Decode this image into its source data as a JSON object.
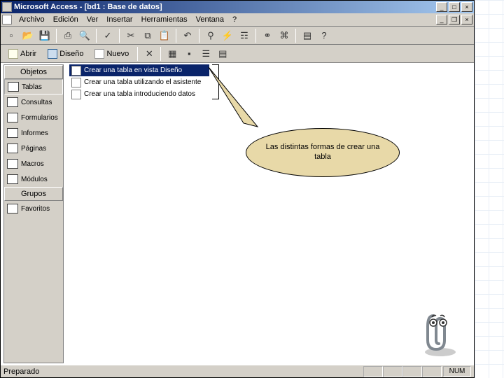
{
  "title": "Microsoft Access - [bd1 : Base de datos]",
  "menu": {
    "items": [
      "Archivo",
      "Edición",
      "Ver",
      "Insertar",
      "Herramientas",
      "Ventana",
      "?"
    ]
  },
  "toolbar1": {
    "icons": [
      "new-doc-icon",
      "open-icon",
      "save-icon",
      "print-icon",
      "preview-icon",
      "spell-icon",
      "cut-icon",
      "copy-icon",
      "paste-icon",
      "undo-icon",
      "link-icon",
      "analyze-icon",
      "props-icon",
      "relations-icon",
      "code-icon",
      "window-icon",
      "help-icon"
    ]
  },
  "toolbar2": {
    "open_label": "Abrir",
    "design_label": "Diseño",
    "new_label": "Nuevo",
    "view_icons": [
      "delete-icon",
      "large-icons-icon",
      "small-icons-icon",
      "list-icon",
      "details-icon"
    ]
  },
  "sidebar": {
    "header_objects": "Objetos",
    "items": [
      {
        "label": "Tablas"
      },
      {
        "label": "Consultas"
      },
      {
        "label": "Formularios"
      },
      {
        "label": "Informes"
      },
      {
        "label": "Páginas"
      },
      {
        "label": "Macros"
      },
      {
        "label": "Módulos"
      }
    ],
    "header_groups": "Grupos",
    "groups": [
      {
        "label": "Favoritos"
      }
    ]
  },
  "create_options": [
    {
      "label": "Crear una tabla en vista Diseño",
      "selected": true
    },
    {
      "label": "Crear una tabla utilizando el asistente",
      "selected": false
    },
    {
      "label": "Crear una tabla introduciendo datos",
      "selected": false
    }
  ],
  "callout": {
    "text": "Las distintas formas de crear una tabla",
    "bg": "#e8d9a8"
  },
  "statusbar": {
    "left": "Preparado",
    "right": "NUM"
  }
}
